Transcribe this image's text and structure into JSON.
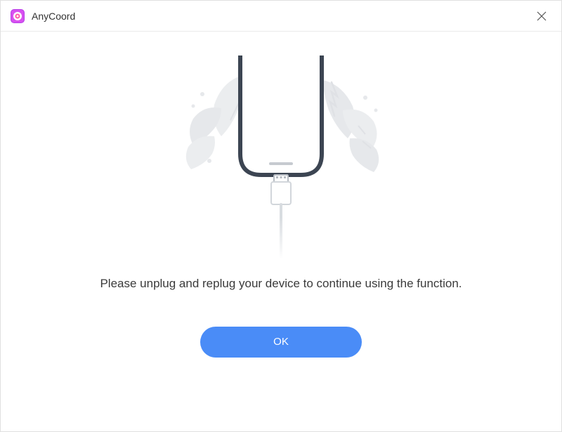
{
  "header": {
    "app_title": "AnyCoord"
  },
  "main": {
    "message": "Please unplug and replug your device to continue using the function.",
    "ok_label": "OK"
  },
  "colors": {
    "accent": "#4a8cf7",
    "logo_primary": "#b73de8",
    "logo_secondary": "#ff5aa8"
  }
}
